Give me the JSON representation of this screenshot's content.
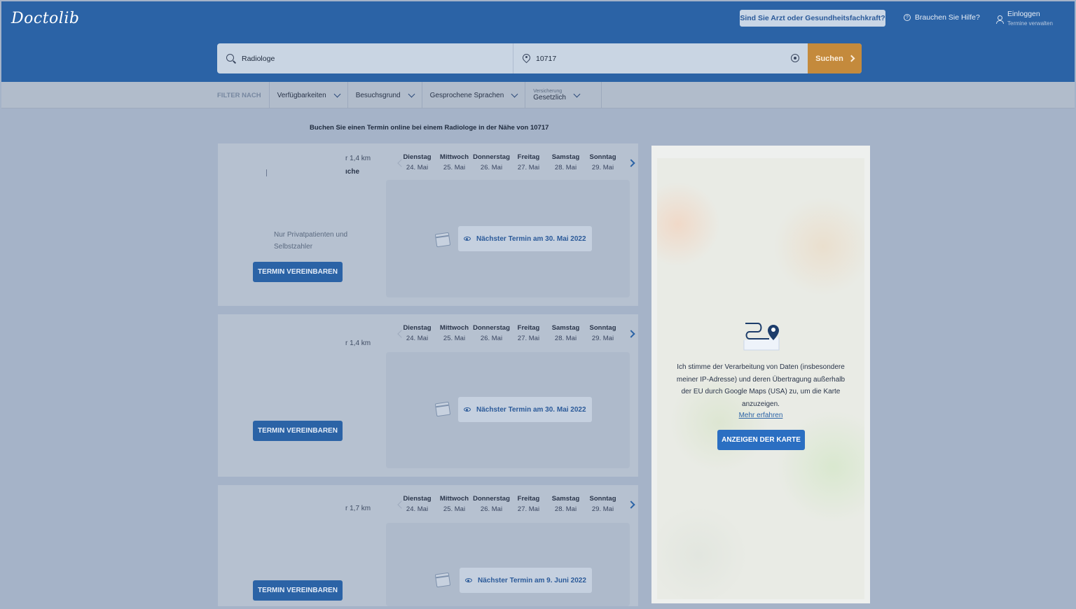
{
  "header": {
    "logo": "Doctolib",
    "pro_button": "Sind Sie Arzt oder Gesundheitsfachkraft?",
    "help": "Brauchen Sie Hilfe?",
    "login_title": "Einloggen",
    "login_sub": "Termine verwalten"
  },
  "search": {
    "query": "Radiologe",
    "location": "10717",
    "button": "Suchen"
  },
  "filters": {
    "label": "FILTER NACH",
    "availability": "Verfügbarkeiten",
    "reason": "Besuchsgrund",
    "languages": "Gesprochene Sprachen",
    "insurance_label": "Versicherung",
    "insurance_value": "Gesetzlich"
  },
  "headline": "Buchen Sie einen Termin online bei einem Radiologe in der Nähe von 10717",
  "days": [
    {
      "name": "Dienstag",
      "date": "24. Mai"
    },
    {
      "name": "Mittwoch",
      "date": "25. Mai"
    },
    {
      "name": "Donnerstag",
      "date": "26. Mai"
    },
    {
      "name": "Freitag",
      "date": "27. Mai"
    },
    {
      "name": "Samstag",
      "date": "28. Mai"
    },
    {
      "name": "Sonntag",
      "date": "29. Mai"
    }
  ],
  "results": [
    {
      "distance": "r 1,4 km",
      "extra": "ıche",
      "note": "Nur Privatpatienten und Selbstzahler",
      "book": "TERMIN VEREINBAREN",
      "next": "Nächster Termin am 30. Mai 2022"
    },
    {
      "distance": "r 1,4 km",
      "book": "TERMIN VEREINBAREN",
      "next": "Nächster Termin am 30. Mai 2022"
    },
    {
      "distance": "r 1,7 km",
      "book": "TERMIN VEREINBAREN",
      "next": "Nächster Termin am 9. Juni 2022"
    }
  ],
  "map": {
    "consent": "Ich stimme der Verarbeitung von Daten (insbesondere meiner IP-Adresse) und deren Übertragung außerhalb der EU durch Google Maps (USA) zu, um die Karte anzuzeigen.",
    "more": "Mehr erfahren",
    "button": "ANZEIGEN DER KARTE"
  }
}
